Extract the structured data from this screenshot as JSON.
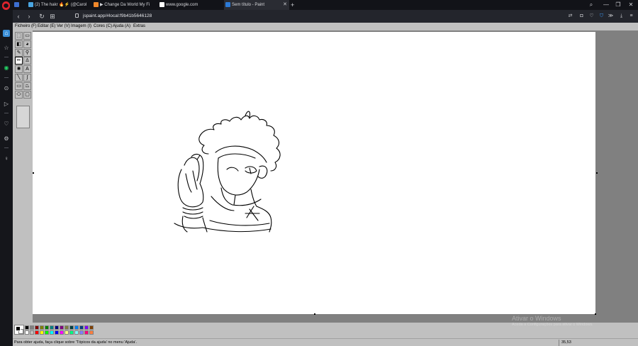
{
  "browser": {
    "tabs": [
      {
        "title": "(2) The hakr 🔥⚡ (@Carol",
        "favicon_color": "#4aa5e0",
        "active": false
      },
      {
        "title": "▶ Change Da World My Fi",
        "favicon_color": "#f0882b",
        "active": false
      },
      {
        "title": "www.google.com",
        "favicon_color": "#ffffff",
        "active": false
      },
      {
        "title": "Sem título - Paint",
        "favicon_color": "#2c7ad6",
        "active": true
      }
    ],
    "address_url": "jspaint.app/#local:f9b41b5646128",
    "accent_color": "#e0242d"
  },
  "paint": {
    "menu": [
      "Ficheiro (F)",
      "Editar (E)",
      "Ver (V)",
      "Imagem (I)",
      "Cores (C)",
      "Ajuda (A)",
      "Extras"
    ],
    "tools": [
      {
        "icon": "free-select-icon",
        "glyph": "⬚"
      },
      {
        "icon": "rect-select-icon",
        "glyph": "▭"
      },
      {
        "icon": "eraser-icon",
        "glyph": "◧"
      },
      {
        "icon": "fill-bucket-icon",
        "glyph": "◕"
      },
      {
        "icon": "color-picker-icon",
        "glyph": "✎"
      },
      {
        "icon": "magnifier-icon",
        "glyph": "⚲"
      },
      {
        "icon": "pencil-icon",
        "glyph": "✏"
      },
      {
        "icon": "brush-icon",
        "glyph": "♙"
      },
      {
        "icon": "airbrush-icon",
        "glyph": "✺"
      },
      {
        "icon": "text-icon",
        "glyph": "A"
      },
      {
        "icon": "line-icon",
        "glyph": "╲"
      },
      {
        "icon": "curve-icon",
        "glyph": "∫"
      },
      {
        "icon": "rectangle-icon",
        "glyph": "▭"
      },
      {
        "icon": "polygon-icon",
        "glyph": "⏢"
      },
      {
        "icon": "ellipse-icon",
        "glyph": "⬭"
      },
      {
        "icon": "rounded-rect-icon",
        "glyph": "▢"
      }
    ],
    "palette_top": [
      "#000000",
      "#808080",
      "#800000",
      "#808000",
      "#008000",
      "#008080",
      "#000080",
      "#800080",
      "#808040",
      "#004040",
      "#0080ff",
      "#004080",
      "#8000ff",
      "#804000"
    ],
    "palette_bottom": [
      "#ffffff",
      "#c0c0c0",
      "#ff0000",
      "#ffff00",
      "#00ff00",
      "#00ffff",
      "#0000ff",
      "#ff00ff",
      "#ffff80",
      "#00ff80",
      "#80ffff",
      "#8080ff",
      "#ff0080",
      "#ff8040"
    ],
    "fg_color": "#000000",
    "bg_color": "#ffffff",
    "status_help": "Para obter ajuda, faça clique sobre 'Tópicos da ajuda' no menu 'Ajuda'.",
    "status_coords": "35,53"
  },
  "watermark": {
    "line1": "Ativar o Windows",
    "line2": "Aceda a Configurações para ativar o Windows."
  }
}
